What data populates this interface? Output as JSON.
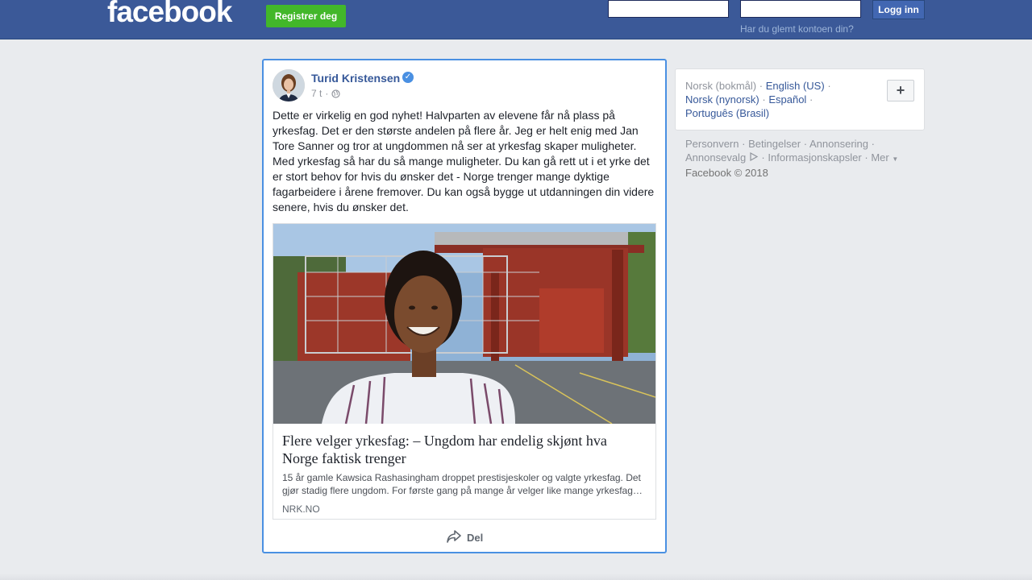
{
  "header": {
    "logo_text": "facebook",
    "register_label": "Registrer deg",
    "login_label": "Logg inn",
    "email_value": "",
    "password_value": "",
    "forgot_link": "Har du glemt kontoen din?"
  },
  "post": {
    "author": "Turid Kristensen",
    "verified": true,
    "time": "7 t",
    "meta_separator": "·",
    "privacy_icon": "globe-icon",
    "text": "Dette er virkelig en god nyhet! Halvparten av elevene får nå plass på yrkesfag. Det er den største andelen på flere år. Jeg er helt enig med Jan Tore Sanner og tror at ungdommen nå ser at yrkesfag skaper muligheter. Med yrkesfag så har du så mange muligheter. Du kan gå rett ut i et yrke det er stort behov for hvis du ønsker det - Norge trenger mange dyktige fagarbeidere i årene fremover. Du kan også bygge ut utdanningen din videre senere, hvis du ønsker det.",
    "link": {
      "title": "Flere velger yrkesfag: – Ungdom har endelig skjønt hva Norge faktisk trenger",
      "description": "15 år gamle Kawsica Rashasingham droppet prestisjeskoler og valgte yrkesfag. Det gjør stadig flere ungdom. For første gang på mange år velger like mange yrkesfag…",
      "source": "NRK.NO"
    },
    "share_label": "Del",
    "share_icon": "share-icon"
  },
  "languages": {
    "current": "Norsk (bokmål)",
    "items": [
      "English (US)",
      "Norsk (nynorsk)",
      "Español",
      "Português (Brasil)"
    ],
    "separator": "·",
    "add_label": "+"
  },
  "footer": {
    "links": [
      "Personvern",
      "Betingelser",
      "Annonsering",
      "Annonsevalg",
      "Informasjonskapsler",
      "Mer"
    ],
    "separator": "·",
    "copyright": "Facebook © 2018"
  },
  "colors": {
    "header_bg": "#3b5998",
    "register_green": "#42b72a",
    "link_blue": "#365899",
    "post_border": "#4a90e2"
  }
}
